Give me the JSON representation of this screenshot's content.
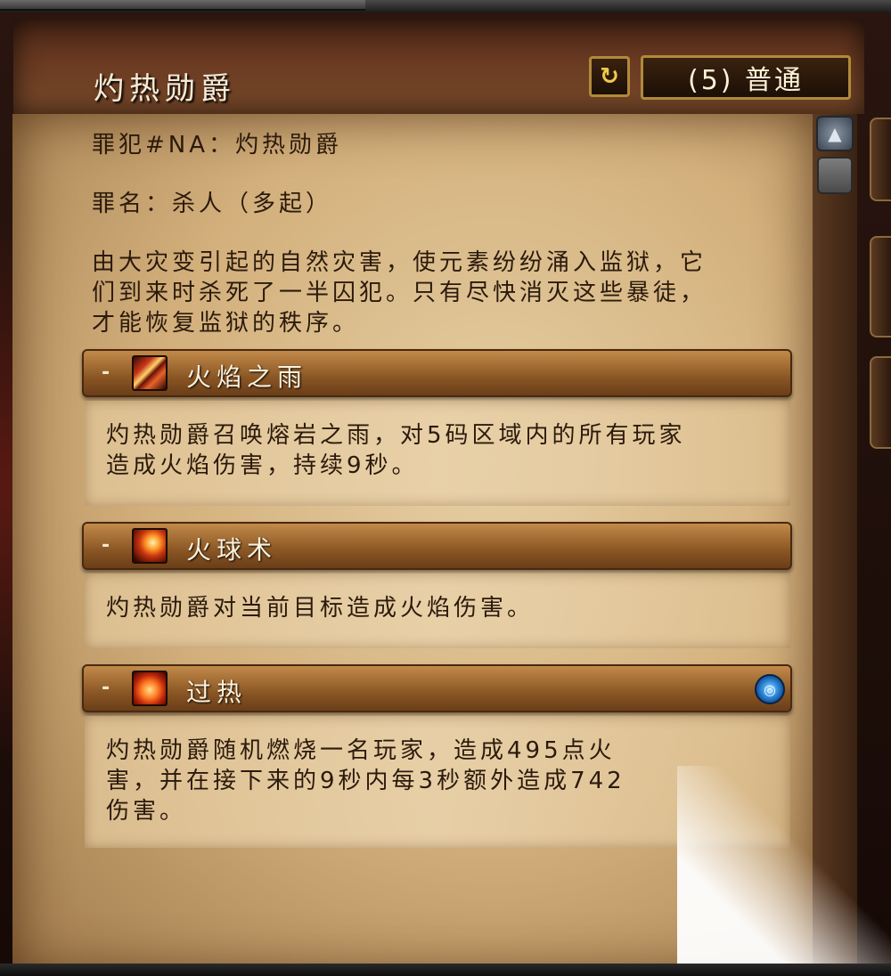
{
  "window": {
    "title": "灼热勋爵",
    "difficulty_label": "(5) 普通",
    "reset_icon": "refresh-icon"
  },
  "intro": {
    "prisoner_line": "罪犯#NA：灼热勋爵",
    "crime_line": "罪名：杀人（多起）",
    "description_lines": [
      "由大灾变引起的自然灾害，使元素纷纷涌入监狱，它",
      "们到来时杀死了一半囚犯。只有尽快消灭这些暴徒，",
      "才能恢复监狱的秩序。"
    ]
  },
  "abilities": [
    {
      "toggle": "-",
      "name": "火焰之雨",
      "icon": "rain-of-fire-icon",
      "description_lines": [
        "灼热勋爵召唤熔岩之雨，对5码区域内的所有玩家",
        "造成火焰伤害，持续9秒。"
      ]
    },
    {
      "toggle": "-",
      "name": "火球术",
      "icon": "fireball-icon",
      "description_lines": [
        "灼热勋爵对当前目标造成火焰伤害。"
      ]
    },
    {
      "toggle": "-",
      "name": "过热",
      "icon": "overheat-icon",
      "tag_icon": "magic-effect-icon",
      "description_lines": [
        "灼热勋爵随机燃烧一名玩家，造成495点火",
        "害，并在接下来的9秒内每3秒额外造成742",
        "伤害。"
      ]
    }
  ],
  "colors": {
    "parchment": "#d3b07c",
    "header": "#8a5624",
    "text": "#2b1a0c",
    "title_text": "#f4ead6"
  }
}
